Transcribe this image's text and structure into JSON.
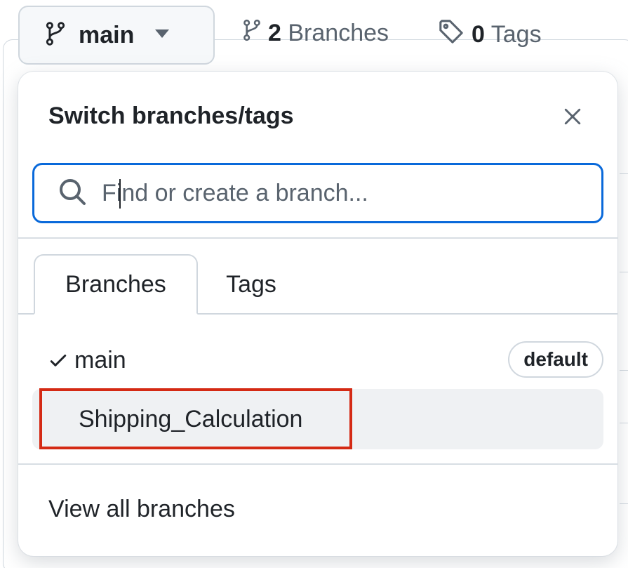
{
  "topbar": {
    "branch_button_label": "main",
    "branches_count": "2",
    "branches_label": "Branches",
    "tags_count": "0",
    "tags_label": "Tags"
  },
  "popover": {
    "title": "Switch branches/tags",
    "search_placeholder": "Find or create a branch...",
    "tabs": [
      {
        "label": "Branches",
        "active": true
      },
      {
        "label": "Tags",
        "active": false
      }
    ],
    "branches": [
      {
        "name": "main",
        "checked": true,
        "badge": "default"
      },
      {
        "name": "Shipping_Calculation",
        "checked": false,
        "highlighted": true
      }
    ],
    "footer_link": "View all branches"
  },
  "colors": {
    "accent": "#0969da",
    "highlight_border": "#d42a14",
    "muted_text": "#59636e"
  }
}
